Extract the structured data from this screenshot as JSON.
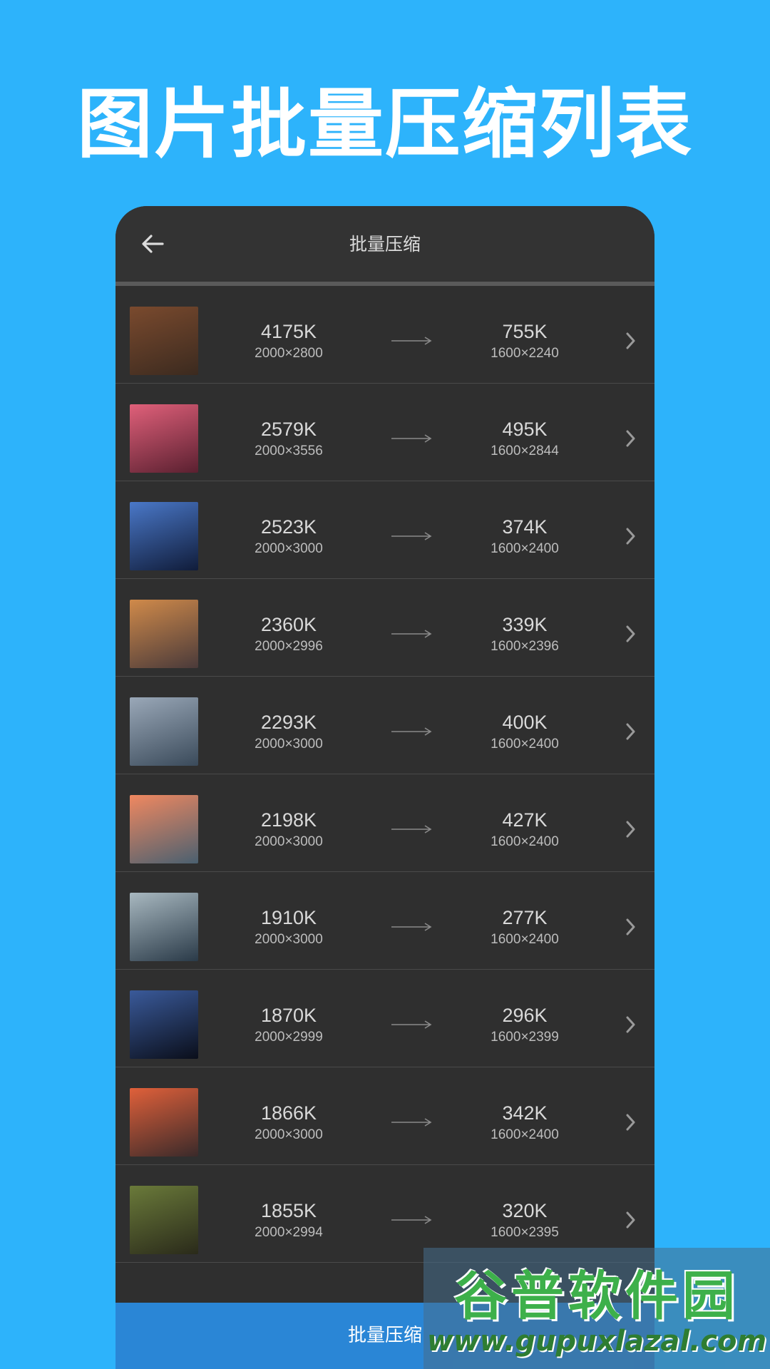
{
  "hero": {
    "title": "图片批量压缩列表"
  },
  "appbar": {
    "title": "批量压缩",
    "back_icon": "arrow-left-icon"
  },
  "rows": [
    {
      "orig_size": "4175K",
      "orig_dim": "2000×2800",
      "comp_size": "755K",
      "comp_dim": "1600×2240",
      "thumb_colors": [
        "#7a4a2e",
        "#3b2a1f"
      ]
    },
    {
      "orig_size": "2579K",
      "orig_dim": "2000×3556",
      "comp_size": "495K",
      "comp_dim": "1600×2844",
      "thumb_colors": [
        "#e0607a",
        "#5a2030"
      ]
    },
    {
      "orig_size": "2523K",
      "orig_dim": "2000×3000",
      "comp_size": "374K",
      "comp_dim": "1600×2400",
      "thumb_colors": [
        "#4a78c8",
        "#101c3a"
      ]
    },
    {
      "orig_size": "2360K",
      "orig_dim": "2000×2996",
      "comp_size": "339K",
      "comp_dim": "1600×2396",
      "thumb_colors": [
        "#d08a4a",
        "#4a3a3a"
      ]
    },
    {
      "orig_size": "2293K",
      "orig_dim": "2000×3000",
      "comp_size": "400K",
      "comp_dim": "1600×2400",
      "thumb_colors": [
        "#9aa8b8",
        "#3a4a5a"
      ]
    },
    {
      "orig_size": "2198K",
      "orig_dim": "2000×3000",
      "comp_size": "427K",
      "comp_dim": "1600×2400",
      "thumb_colors": [
        "#f08860",
        "#4a6070"
      ]
    },
    {
      "orig_size": "1910K",
      "orig_dim": "2000×3000",
      "comp_size": "277K",
      "comp_dim": "1600×2400",
      "thumb_colors": [
        "#a8b8c0",
        "#2a3a48"
      ]
    },
    {
      "orig_size": "1870K",
      "orig_dim": "2000×2999",
      "comp_size": "296K",
      "comp_dim": "1600×2399",
      "thumb_colors": [
        "#3a5a9a",
        "#0a0e1a"
      ]
    },
    {
      "orig_size": "1866K",
      "orig_dim": "2000×3000",
      "comp_size": "342K",
      "comp_dim": "1600×2400",
      "thumb_colors": [
        "#e0603a",
        "#3a2a2a"
      ]
    },
    {
      "orig_size": "1855K",
      "orig_dim": "2000×2994",
      "comp_size": "320K",
      "comp_dim": "1600×2395",
      "thumb_colors": [
        "#6a7a3a",
        "#2a2a1a"
      ]
    }
  ],
  "bottom_button": {
    "label": "批量压缩"
  },
  "watermark": {
    "logo": "谷普软件园",
    "url": "www.gupuxlazal.com"
  },
  "colors": {
    "background": "#2db3fb",
    "panel": "#2f2f2f",
    "accent_button": "#2a86d6"
  }
}
